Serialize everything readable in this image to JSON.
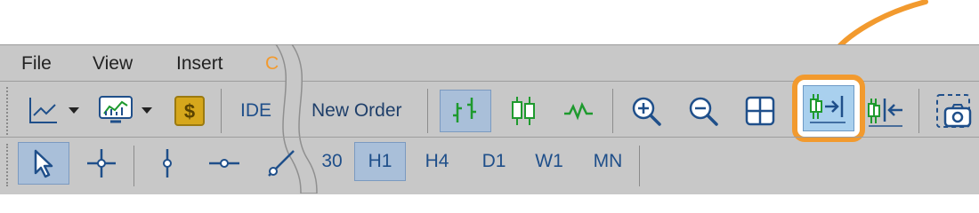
{
  "menu": {
    "file": "File",
    "view": "View",
    "insert": "Insert",
    "partial": "C"
  },
  "toolbar": {
    "ide_label": "IDE",
    "new_order_label": "New Order"
  },
  "timeframes": {
    "m30_partial": "30",
    "h1": "H1",
    "h4": "H4",
    "d1": "D1",
    "w1": "W1",
    "mn": "MN"
  },
  "colors": {
    "accent_orange": "#f29a2e",
    "icon_blue": "#1f4f8a",
    "icon_green": "#1e9a2e",
    "active_bg": "#a9bfd9",
    "highlight_bg": "#a9d0ee"
  }
}
